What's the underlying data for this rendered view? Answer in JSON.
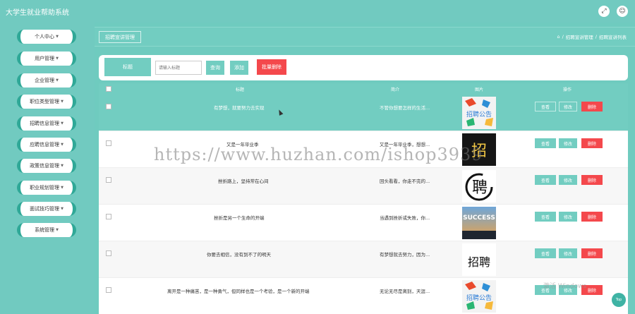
{
  "app": {
    "title": "大学生就业帮助系统"
  },
  "topbar": {
    "fullscreen_icon": "fullscreen-icon",
    "user_icon": "user-icon"
  },
  "sidebar": {
    "items": [
      {
        "label": "个人中心"
      },
      {
        "label": "用户管理"
      },
      {
        "label": "企业管理"
      },
      {
        "label": "职位类型管理"
      },
      {
        "label": "招聘信息管理"
      },
      {
        "label": "应聘信息管理"
      },
      {
        "label": "政策信息管理"
      },
      {
        "label": "职业规划管理"
      },
      {
        "label": "面试技巧管理"
      },
      {
        "label": "系统管理"
      }
    ]
  },
  "breadcrumb": {
    "tab": "招聘宣讲管理",
    "home_icon": "home-icon",
    "path1": "招聘宣讲管理",
    "path2": "招聘宣讲列表"
  },
  "search": {
    "label": "标题",
    "placeholder": "请输入标题",
    "query_btn": "查询",
    "add_btn": "添加",
    "batch_delete_btn": "批量删除"
  },
  "table": {
    "headers": {
      "title": "标题",
      "intro": "简介",
      "image": "图片",
      "ops": "操作"
    },
    "actions": {
      "view": "查看",
      "edit": "修改",
      "delete": "删除"
    },
    "rows": [
      {
        "title": "有梦想，就要努力去实现",
        "intro": "不管你想要怎样的生活..."
      },
      {
        "title": "又是一年毕业季",
        "intro": "又是一年毕业季，想想..."
      },
      {
        "title": "挫折路上，坚持常在心间",
        "intro": "回头看看，你走不完的..."
      },
      {
        "title": "挫折是另一个生命的开端",
        "intro": "当遇到挫折或失败，你..."
      },
      {
        "title": "你要去相信，没有到不了的明天",
        "intro": "有梦想就去努力，因为..."
      },
      {
        "title": "离开是一种痛苦，是一种勇气，但同样也是一个考验，是一个新的开端",
        "intro": "无论无尽是离别，天涯..."
      }
    ],
    "images": [
      {
        "label": "招聘公告"
      },
      {
        "label": "招"
      },
      {
        "label": "聘"
      },
      {
        "label": "SUCCESS"
      },
      {
        "label": "招聘"
      },
      {
        "label": "招聘公告"
      }
    ]
  },
  "overlay": {
    "watermark": "https://www.huzhan.com/ishop3939",
    "windows_mark": "激活 Windows",
    "top_btn": "Top"
  }
}
